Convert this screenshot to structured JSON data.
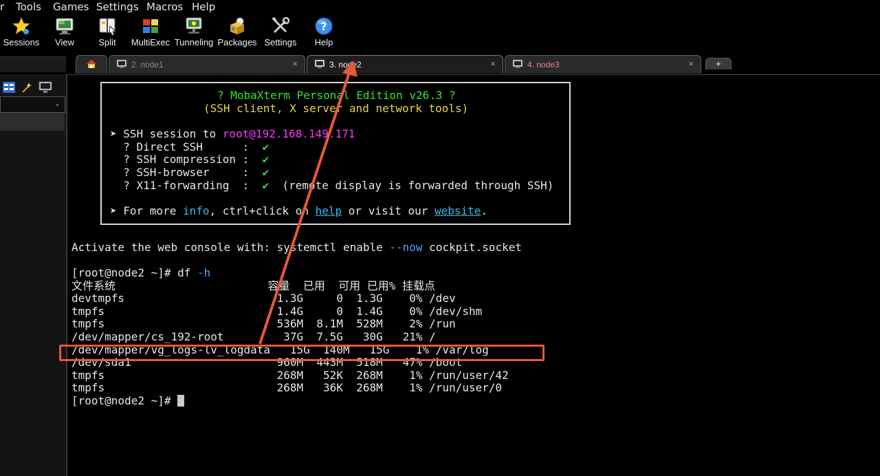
{
  "menu": [
    "r",
    "Tools",
    "Games",
    "Settings",
    "Macros",
    "Help"
  ],
  "toolbar": [
    {
      "label": "Sessions",
      "icon": "star-icon"
    },
    {
      "label": "View",
      "icon": "monitor-icon"
    },
    {
      "label": "Split",
      "icon": "split-icon"
    },
    {
      "label": "MultiExec",
      "icon": "multiexec-icon"
    },
    {
      "label": "Tunneling",
      "icon": "tunneling-icon"
    },
    {
      "label": "Packages",
      "icon": "packages-icon"
    },
    {
      "label": "Settings",
      "icon": "wrench-icon"
    },
    {
      "label": "Help",
      "icon": "help-icon"
    }
  ],
  "tabs": [
    {
      "label": "2. node1",
      "close": "×"
    },
    {
      "label": "3. node2",
      "close": "×"
    },
    {
      "label": "4. node3",
      "close": "×"
    }
  ],
  "new_tab": "+",
  "banner": {
    "title": "? MobaXterm Personal Edition v26.3 ?",
    "subtitle": "(SSH client, X server and network tools)",
    "ssh_prefix": "➤ SSH session to ",
    "ssh_host": "root@192.168.149.171",
    "features": [
      {
        "name": "  ? Direct SSH      :  ",
        "check": "✔",
        "note": ""
      },
      {
        "name": "  ? SSH compression :  ",
        "check": "✔",
        "note": ""
      },
      {
        "name": "  ? SSH-browser     :  ",
        "check": "✔",
        "note": ""
      },
      {
        "name": "  ? X11-forwarding  :  ",
        "check": "✔",
        "note": "  (remote display is forwarded through SSH)"
      }
    ],
    "more_prefix": "➤ For more ",
    "more_info": "info",
    "more_mid": ", ctrl+click on ",
    "more_help": "help",
    "more_mid2": " or visit our ",
    "more_website": "website",
    "more_end": "."
  },
  "terminal": {
    "activate_prefix": "Activate the web console with: systemctl enable ",
    "activate_flag": "--now",
    "activate_suffix": " cockpit.socket",
    "prompt1": "[root@node2 ~]# df ",
    "prompt1_flag": "-h",
    "df_header": "文件系统                       容量  已用  可用 已用% 挂载点",
    "df_rows": [
      "devtmpfs                       1.3G     0  1.3G    0% /dev",
      "tmpfs                          1.4G     0  1.4G    0% /dev/shm",
      "tmpfs                          536M  8.1M  528M    2% /run",
      "/dev/mapper/cs_192-root         37G  7.5G   30G   21% /",
      "/dev/mapper/vg_logs-lv_logdata   15G  140M   15G    1% /var/log",
      "/dev/sda1                      960M  443M  518M   47% /boot",
      "tmpfs                          268M   52K  268M    1% /run/user/42",
      "tmpfs                          268M   36K  268M    1% /run/user/0"
    ],
    "prompt2": "[root@node2 ~]# "
  },
  "colors": {
    "highlight": "#e8583a",
    "link": "#39b9e6",
    "host": "#ff35ff",
    "title": "#33e633",
    "subtitle": "#e6d642"
  }
}
